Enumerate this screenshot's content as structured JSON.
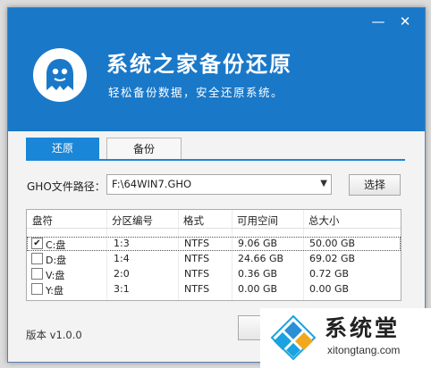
{
  "app": {
    "title": "系统之家备份还原",
    "subtitle": "轻松备份数据，安全还原系统。",
    "window_controls": {
      "minimize": "—",
      "close": "✕"
    }
  },
  "tabs": [
    {
      "label": "还原",
      "active": true
    },
    {
      "label": "备份",
      "active": false
    }
  ],
  "gho": {
    "label": "GHO文件路径：",
    "path_value": "F:\\64WIN7.GHO",
    "browse_label": "选择"
  },
  "table": {
    "headers": [
      "盘符",
      "分区编号",
      "格式",
      "可用空间",
      "总大小"
    ],
    "rows": [
      {
        "drive": "C:盘",
        "partition": "1:3",
        "format": "NTFS",
        "free": "9.06 GB",
        "total": "50.00 GB",
        "checked": true
      },
      {
        "drive": "D:盘",
        "partition": "1:4",
        "format": "NTFS",
        "free": "24.66 GB",
        "total": "69.02 GB",
        "checked": false
      },
      {
        "drive": "V:盘",
        "partition": "2:0",
        "format": "NTFS",
        "free": "0.36 GB",
        "total": "0.72 GB",
        "checked": false
      },
      {
        "drive": "Y:盘",
        "partition": "3:1",
        "format": "NTFS",
        "free": "0.00 GB",
        "total": "0.00 GB",
        "checked": false
      }
    ]
  },
  "footer": {
    "version": "版本 v1.0.0"
  },
  "watermark": {
    "title": "系统堂",
    "url": "xitongtang.com"
  },
  "colors": {
    "banner": "#1a78c8",
    "tab_active": "#1a86d8"
  }
}
